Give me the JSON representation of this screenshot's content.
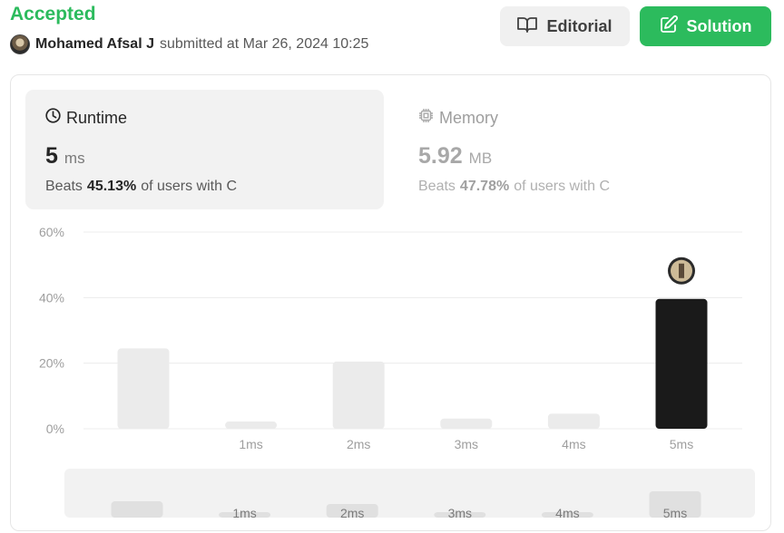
{
  "submission": {
    "status": "Accepted",
    "author": "Mohamed Afsal J",
    "submitted_text": "submitted at Mar 26, 2024 10:25"
  },
  "buttons": {
    "editorial_label": "Editorial",
    "solution_label": "Solution"
  },
  "runtime": {
    "title": "Runtime",
    "value": "5",
    "unit": "ms",
    "beats_prefix": "Beats",
    "beats_pct": "45.13%",
    "beats_suffix": "of users with C"
  },
  "memory": {
    "title": "Memory",
    "value": "5.92",
    "unit": "MB",
    "beats_prefix": "Beats",
    "beats_pct": "47.78%",
    "beats_suffix": "of users with C"
  },
  "colors": {
    "accent": "#2cbb5d",
    "bar": "#ebebeb",
    "bar_active": "#1a1a1a",
    "brush_bg": "#f2f2f2",
    "brush_bar": "#e0e0e0"
  },
  "chart_data": {
    "type": "bar",
    "categories": [
      "",
      "1ms",
      "2ms",
      "3ms",
      "4ms",
      "5ms"
    ],
    "values": [
      24.5,
      2.2,
      20.5,
      3.1,
      4.6,
      39.6
    ],
    "highlight_index": 5,
    "yticks": [
      "60%",
      "40%",
      "20%",
      "0%"
    ],
    "ylim": [
      0,
      60
    ],
    "grid": true,
    "brush": {
      "values": [
        24.5,
        2.2,
        20.5,
        3.1,
        4.6,
        39.6
      ]
    }
  }
}
